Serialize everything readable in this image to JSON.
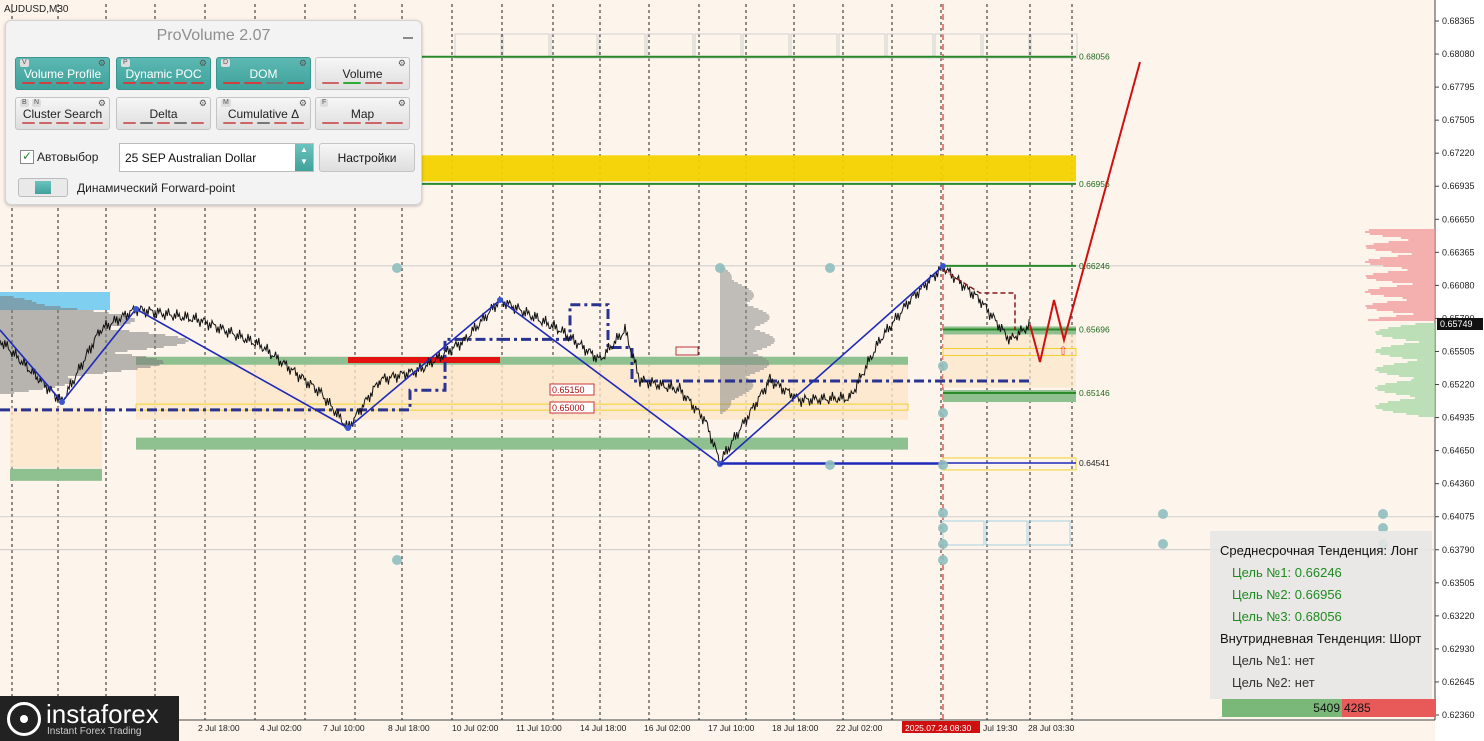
{
  "chart": {
    "symbol": "AUDUSD,M30",
    "price_levels": [
      "0.68365",
      "0.68080",
      "0.67795",
      "0.67505",
      "0.67220",
      "0.66935",
      "0.66650",
      "0.66365",
      "0.66080",
      "0.65790",
      "0.65505",
      "0.65220",
      "0.64935",
      "0.64650",
      "0.64360",
      "0.64075",
      "0.63790",
      "0.63505",
      "0.63220",
      "0.62930",
      "0.62645",
      "0.62360"
    ],
    "current_price": "0.65749",
    "time_labels": [
      "2 Jul 18:00",
      "4 Jul 02:00",
      "7 Jul 10:00",
      "8 Jul 18:00",
      "10 Jul 02:00",
      "11 Jul 10:00",
      "14 Jul 18:00",
      "16 Jul 02:00",
      "17 Jul 10:00",
      "18 Jul 18:00",
      "22 Jul 02:00",
      "2025.07.24 08:30",
      "Jul 19:30",
      "28 Jul 03:30"
    ],
    "level_labels": [
      "0.68056",
      "0.66956",
      "0.66246",
      "0.65696",
      "0.65146",
      "0.64541"
    ],
    "annotations": [
      "0.65150",
      "0.65000"
    ],
    "colors": {
      "background": "#fdf4ec",
      "zigzag": "#1f2ab8",
      "forecast": "#d01010",
      "target_line": "#2a8a2a",
      "zone_yellow": "#f5d200",
      "zone_green": "#8fc08f",
      "grid": "#222222"
    }
  },
  "panel": {
    "title": "ProVolume 2.07",
    "buttons": [
      {
        "label": "Volume Profile",
        "hotkey": "V",
        "state": "on"
      },
      {
        "label": "Dynamic POC",
        "hotkey": "P",
        "state": "on"
      },
      {
        "label": "DOM",
        "hotkey": "D",
        "state": "on"
      },
      {
        "label": "Volume",
        "hotkey": "",
        "state": "off"
      },
      {
        "label": "Cluster Search",
        "hotkey": "B",
        "hotkey2": "N",
        "state": "off"
      },
      {
        "label": "Delta",
        "hotkey": "",
        "state": "off"
      },
      {
        "label": "Cumulative Δ",
        "hotkey": "M",
        "state": "off"
      },
      {
        "label": "Map",
        "hotkey": "F",
        "state": "off"
      }
    ],
    "auto_select_label": "Автовыбор",
    "instrument": "25 SEP Australian Dollar",
    "settings_label": "Настройки",
    "forward_point_label": "Динамический Forward-point"
  },
  "trend": {
    "medium_title": "Среднесрочная Тенденция: Лонг",
    "targets_long": [
      "Цель №1: 0.66246",
      "Цель №2: 0.66956",
      "Цель №3: 0.68056"
    ],
    "intraday_title": "Внутридневная Тенденция: Шорт",
    "targets_short": [
      "Цель №1: нет",
      "Цель №2: нет"
    ]
  },
  "volumes": {
    "buy": "5409",
    "sell": "4285"
  },
  "logo": {
    "name": "instaforex",
    "tagline": "Instant Forex Trading"
  }
}
